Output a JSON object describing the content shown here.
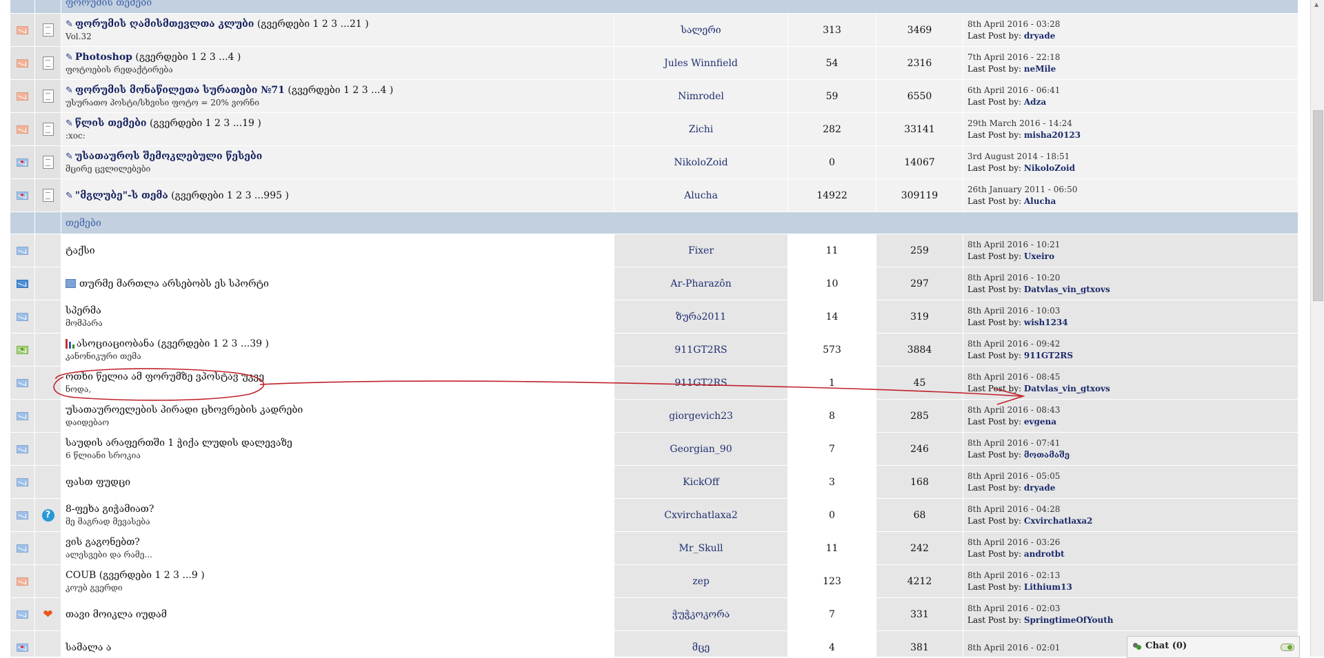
{
  "section_header_partial": "ფორუმის თემები",
  "pinned": [
    {
      "title": "ფორუმის ღამისმთევლთა კლუბი",
      "pages": "(გვერდები 1 2 3 ...21 )",
      "desc": "Vol.32",
      "author": "სალერი",
      "replies": "313",
      "views": "3469",
      "date": "8th April 2016 - 03:28",
      "by_label": "Last Post by:",
      "by": "dryade",
      "status": "orange"
    },
    {
      "title": "Photoshop",
      "pages": "(გვერდები 1 2 3 ...4 )",
      "desc": "ფოტოების რედაქტირება",
      "author": "Jules Winnfield",
      "replies": "54",
      "views": "2316",
      "date": "7th April 2016 - 22:18",
      "by_label": "Last Post by:",
      "by": "neMile",
      "status": "orange"
    },
    {
      "title": "ფორუმის მონაწილეთა სურათები №71",
      "pages": "(გვერდები 1 2 3 ...4 )",
      "desc": "უსურათო პოსტი/სხვისი ფოტო = 20% ვორნი",
      "author": "Nimrodel",
      "replies": "59",
      "views": "6550",
      "date": "6th April 2016 - 06:41",
      "by_label": "Last Post by:",
      "by": "Adza",
      "status": "orange"
    },
    {
      "title": "წლის თემები",
      "pages": "(გვერდები 1 2 3 ...19 )",
      "desc": ":xoc:",
      "author": "Zichi",
      "replies": "282",
      "views": "33141",
      "date": "29th March 2016 - 14:24",
      "by_label": "Last Post by:",
      "by": "misha20123",
      "status": "orange"
    },
    {
      "title": "უსათაუროს შემოკლებული წესები",
      "pages": "",
      "desc": "მცირე ცვლილებები",
      "author": "NikoloZoid",
      "replies": "0",
      "views": "14067",
      "date": "3rd August 2014 - 18:51",
      "by_label": "Last Post by:",
      "by": "NikoloZoid",
      "status": "red"
    },
    {
      "title": "\"მგლუბე\"-ს თემა",
      "pages": "(გვერდები 1 2 3 ...995 )",
      "desc": "",
      "author": "Alucha",
      "replies": "14922",
      "views": "309119",
      "date": "26th January 2011 - 06:50",
      "by_label": "Last Post by:",
      "by": "Alucha",
      "status": "red"
    }
  ],
  "topics_header": "თემები",
  "topics": [
    {
      "title": "ტაქსი",
      "pages": "",
      "desc": "",
      "author": "Fixer",
      "replies": "11",
      "views": "259",
      "date": "8th April 2016 - 10:21",
      "by_label": "Last Post by:",
      "by": "Uxeiro",
      "status": "plain",
      "icon": ""
    },
    {
      "title": "თურმე მართლა არსებობს ეს სპორტი",
      "pages": "",
      "desc": "",
      "author": "Ar-Pharazôn",
      "replies": "10",
      "views": "297",
      "date": "8th April 2016 - 10:20",
      "by_label": "Last Post by:",
      "by": "Datvlas_vin_gtxovs",
      "status": "dark",
      "icon": "image"
    },
    {
      "title": "სპერმა",
      "pages": "",
      "desc": "მომპარა",
      "author": "ზურა2011",
      "replies": "14",
      "views": "319",
      "date": "8th April 2016 - 10:03",
      "by_label": "Last Post by:",
      "by": "wish1234",
      "status": "plain",
      "icon": ""
    },
    {
      "title": "ასოციაციობანა",
      "pages": "(გვერდები 1 2 3 ...39 )",
      "desc": "კანონიკური თემა",
      "author": "911GT2RS",
      "replies": "573",
      "views": "3884",
      "date": "8th April 2016 - 09:42",
      "by_label": "Last Post by:",
      "by": "911GT2RS",
      "status": "green",
      "icon": "poll"
    },
    {
      "title": "ოთხი წელია ამ ფორუმზე ვპოსტავ უკვე",
      "pages": "",
      "desc": "ნოდა,",
      "author": "911GT2RS",
      "replies": "1",
      "views": "45",
      "date": "8th April 2016 - 08:45",
      "by_label": "Last Post by:",
      "by": "Datvlas_vin_gtxovs",
      "status": "plain",
      "icon": ""
    },
    {
      "title": "უსათაუროელების პირადი ცხოვრების კადრები",
      "pages": "",
      "desc": "დაიდებაო",
      "author": "giorgevich23",
      "replies": "8",
      "views": "285",
      "date": "8th April 2016 - 08:43",
      "by_label": "Last Post by:",
      "by": "evgena",
      "status": "plain",
      "icon": ""
    },
    {
      "title": "საუდის არაფერთში 1 ჭიქა ლუდის დალევაზე",
      "pages": "",
      "desc": "6 წლიანი სროკია",
      "author": "Georgian_90",
      "replies": "7",
      "views": "246",
      "date": "8th April 2016 - 07:41",
      "by_label": "Last Post by:",
      "by": "მოთამაშე",
      "status": "plain",
      "icon": ""
    },
    {
      "title": "ფასთ ფუდცი",
      "pages": "",
      "desc": "",
      "author": "KickOff",
      "replies": "3",
      "views": "168",
      "date": "8th April 2016 - 05:05",
      "by_label": "Last Post by:",
      "by": "dryade",
      "status": "plain",
      "icon": ""
    },
    {
      "title": "8-ფეხა გიჭამიათ?",
      "pages": "",
      "desc": "მე მაგრად მევასება",
      "author": "Cxvirchatlaxa2",
      "replies": "0",
      "views": "68",
      "date": "8th April 2016 - 04:28",
      "by_label": "Last Post by:",
      "by": "Cxvirchatlaxa2",
      "status": "plain",
      "icon": "question"
    },
    {
      "title": "ვის გაგონებთ?",
      "pages": "",
      "desc": "ალესვები და რამე...",
      "author": "Mr_Skull",
      "replies": "11",
      "views": "242",
      "date": "8th April 2016 - 03:26",
      "by_label": "Last Post by:",
      "by": "androtbt",
      "status": "plain",
      "icon": ""
    },
    {
      "title": "COUB",
      "pages": "(გვერდები 1 2 3 ...9 )",
      "desc": "კოუბ გვერდი",
      "author": "zep",
      "replies": "123",
      "views": "4212",
      "date": "8th April 2016 - 02:13",
      "by_label": "Last Post by:",
      "by": "Lithium13",
      "status": "orange",
      "icon": ""
    },
    {
      "title": "თავი მოიკლა იუდამ",
      "pages": "",
      "desc": "",
      "author": "ჭუჭკოკორა",
      "replies": "7",
      "views": "331",
      "date": "8th April 2016 - 02:03",
      "by_label": "Last Post by:",
      "by": "SpringtimeOfYouth",
      "status": "plain",
      "icon": "heart"
    },
    {
      "title": "სამალა ა",
      "pages": "",
      "desc": "",
      "author": "მცე",
      "replies": "4",
      "views": "381",
      "date": "8th April 2016 - 02:01",
      "by_label": "",
      "by": "",
      "status": "red",
      "icon": ""
    }
  ],
  "chat": {
    "label": "Chat",
    "count": "(0)"
  },
  "colors": {
    "header_bg": "#c2d0e0",
    "section_text": "#3f63a8",
    "link": "#1b2a6b",
    "annotation": "#c0202a"
  },
  "icons": {
    "pinned_marker": "pin-icon",
    "topic_file": "document-icon",
    "status": "envelope-icon"
  }
}
